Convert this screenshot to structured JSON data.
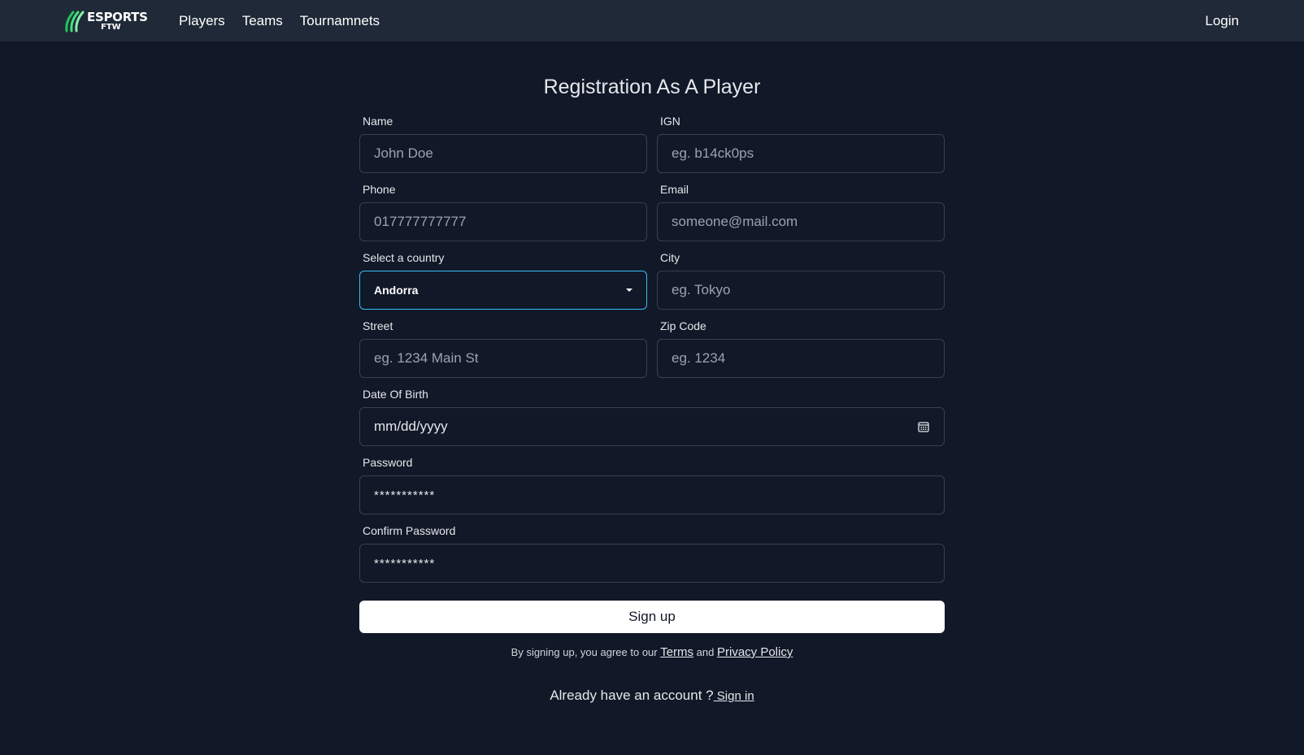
{
  "brand": {
    "name": "ESPORTS",
    "sub": "FTW",
    "accent": "#22c55e"
  },
  "nav": {
    "items": [
      {
        "label": "Players"
      },
      {
        "label": "Teams"
      },
      {
        "label": "Tournamnets"
      }
    ],
    "login_label": "Login"
  },
  "form": {
    "title": "Registration As A Player",
    "name": {
      "label": "Name",
      "placeholder": "John Doe"
    },
    "ign": {
      "label": "IGN",
      "placeholder": "eg. b14ck0ps"
    },
    "phone": {
      "label": "Phone",
      "placeholder": "017777777777"
    },
    "email": {
      "label": "Email",
      "placeholder": "someone@mail.com"
    },
    "country": {
      "label": "Select a country",
      "value": "Andorra"
    },
    "city": {
      "label": "City",
      "placeholder": "eg. Tokyo"
    },
    "street": {
      "label": "Street",
      "placeholder": "eg. 1234 Main St"
    },
    "zip": {
      "label": "Zip Code",
      "placeholder": "eg. 1234"
    },
    "dob": {
      "label": "Date Of Birth",
      "value": "mm/dd/yyyy"
    },
    "password": {
      "label": "Password",
      "value": "***********"
    },
    "confirm_password": {
      "label": "Confirm Password",
      "value": "***********"
    },
    "submit_label": "Sign up",
    "terms": {
      "prefix": "By signing up, you agree to our ",
      "terms_link": "Terms",
      "middle": " and ",
      "privacy_link": "Privacy Policy"
    },
    "signin": {
      "prefix": "Already have an account ?",
      "link": " Sign in"
    }
  },
  "colors": {
    "background": "#111827",
    "navbar": "#1f2937",
    "select_focus_border": "#38bdf8"
  }
}
